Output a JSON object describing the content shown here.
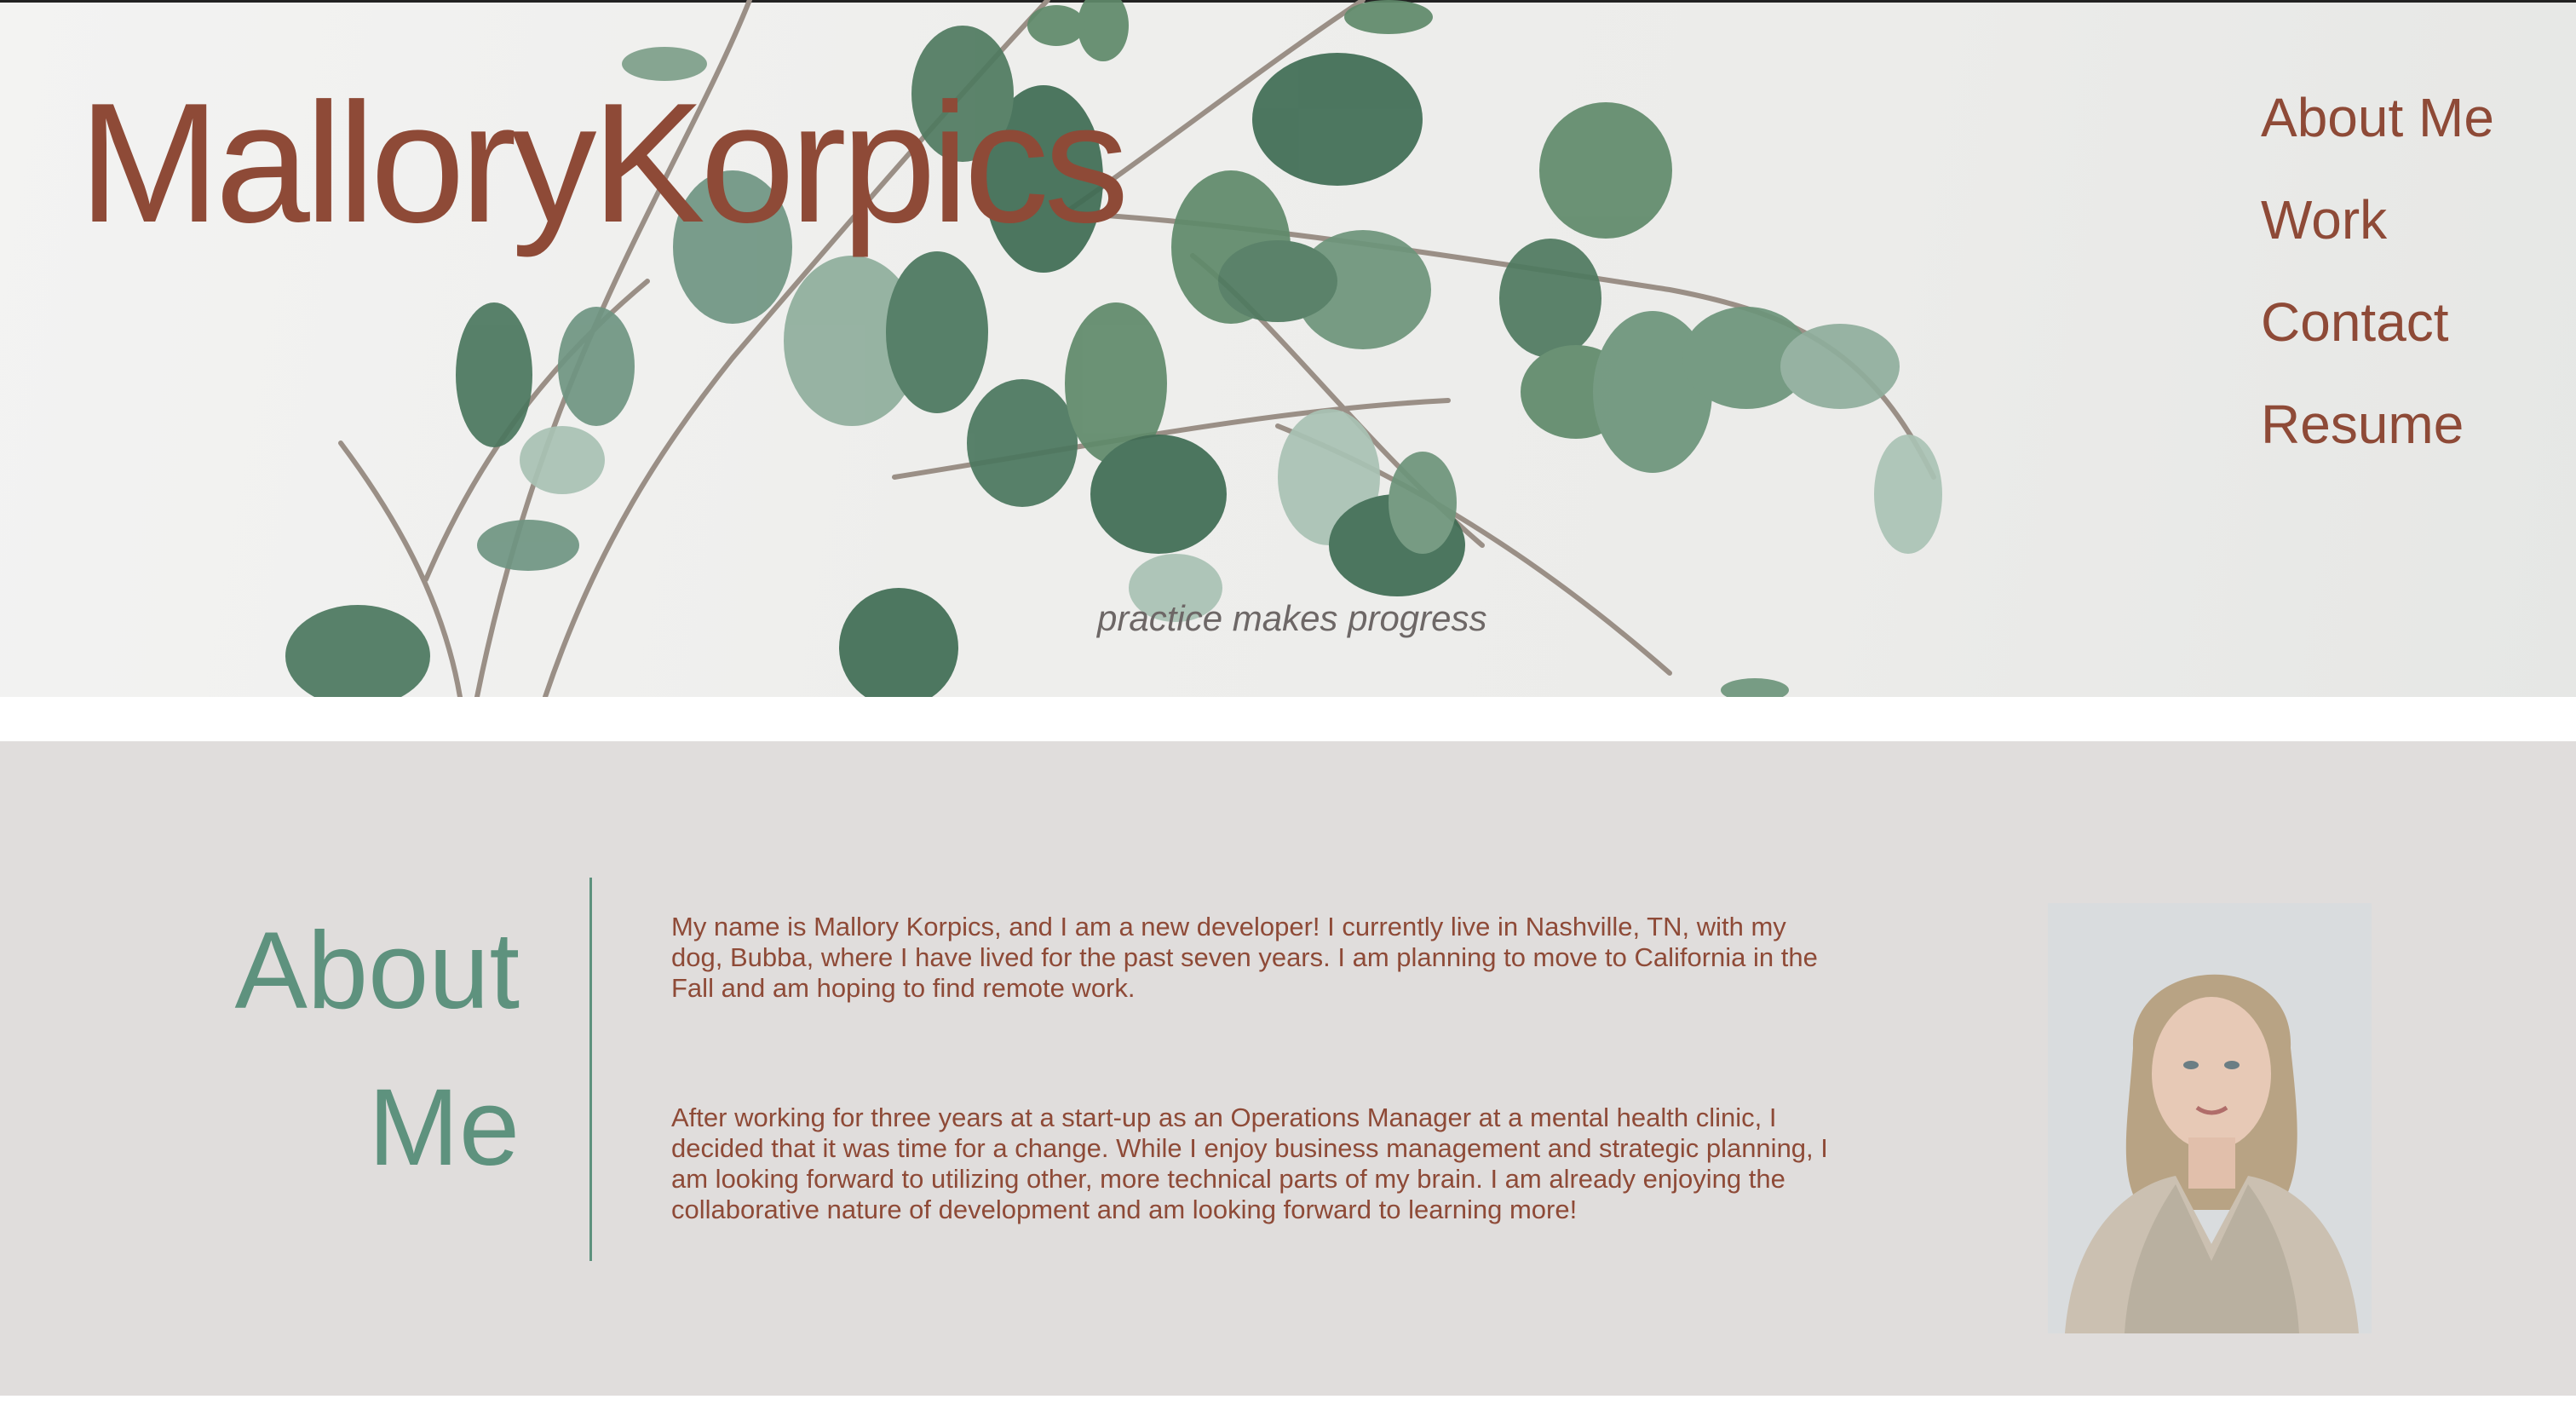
{
  "site": {
    "title": "MalloryKorpics",
    "tagline": "practice makes progress"
  },
  "nav": {
    "items": [
      {
        "label": "About Me"
      },
      {
        "label": "Work"
      },
      {
        "label": "Contact"
      },
      {
        "label": "Resume"
      }
    ]
  },
  "about": {
    "heading_line1": "About",
    "heading_line2": "Me",
    "paragraph1": "My name is Mallory Korpics, and I am a new developer! I currently live in Nashville, TN, with my dog, Bubba, where I have lived for the past seven years. I am planning to move to California in the Fall and am hoping to find remote work.",
    "paragraph2": "After working for three years at a start-up as an Operations Manager at a mental health clinic, I decided that it was time for a change. While I enjoy business management and strategic planning, I am looking forward to utilizing other, more technical parts of my brain. I am already enjoying the collaborative nature of development and am looking forward to learning more!"
  },
  "colors": {
    "accent_rust": "#8e4a37",
    "accent_green": "#5e927e",
    "section_bg": "#e0dddc"
  }
}
